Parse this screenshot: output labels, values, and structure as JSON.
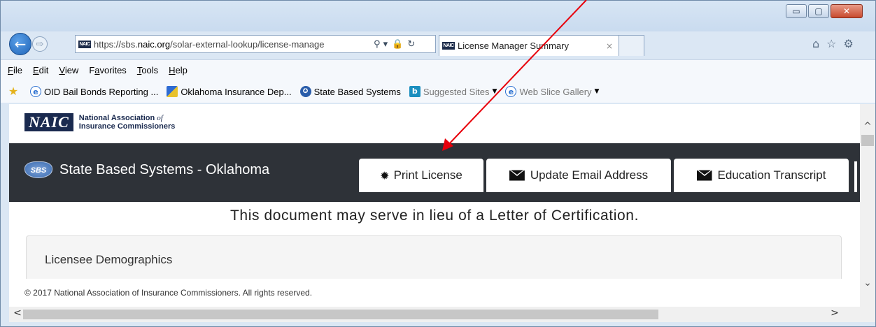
{
  "window": {
    "minimize_glyph": "▭",
    "maximize_glyph": "▢",
    "close_glyph": "✕"
  },
  "nav": {
    "back_glyph": "←",
    "forward_glyph": "⇨"
  },
  "address_bar": {
    "favicon_text": "NAIC",
    "url_prefix": "https://sbs.",
    "url_domain": "naic.org",
    "url_rest": "/solar-external-lookup/license-manage",
    "search_glyph": "⚲ ▾",
    "lock_glyph": "🔒",
    "refresh_glyph": "↻"
  },
  "tabs": {
    "active_label": "License Manager Summary",
    "close_glyph": "×"
  },
  "toolbar_icons": {
    "home": "⌂",
    "favorites": "☆",
    "settings": "⚙"
  },
  "menu": {
    "items": [
      {
        "u": "F",
        "rest": "ile"
      },
      {
        "u": "E",
        "rest": "dit"
      },
      {
        "u": "V",
        "rest": "iew"
      },
      {
        "pre": "F",
        "u": "a",
        "rest": "vorites"
      },
      {
        "u": "T",
        "rest": "ools"
      },
      {
        "u": "H",
        "rest": "elp"
      }
    ]
  },
  "favorites": {
    "star_glyph": "★",
    "items": [
      {
        "label": "OID Bail Bonds Reporting ...",
        "icon": "ie-icon"
      },
      {
        "label": "Oklahoma Insurance Dep...",
        "icon": "ok-icon"
      },
      {
        "label": "State Based Systems",
        "icon": "sbs-icon"
      },
      {
        "label": "Suggested Sites",
        "icon": "bing-icon"
      },
      {
        "label": "Web Slice Gallery",
        "icon": "ie-icon"
      }
    ],
    "dropdown_glyph": "▼"
  },
  "page": {
    "naic_logo": "NAIC",
    "naic_name_line1_a": "National Association ",
    "naic_name_line1_b": "of",
    "naic_name_line2": "Insurance Commissioners",
    "brand_logo": "SBS",
    "brand_title": "State Based Systems - Oklahoma",
    "nav_buttons": {
      "print_icon": "✹",
      "print": "Print License",
      "email": "Update Email Address",
      "education": "Education Transcript"
    },
    "notice": "This document may serve in lieu of a Letter of Certification.",
    "demographics_title": "Licensee Demographics",
    "footer": "© 2017 National Association of Insurance Commissioners. All rights reserved."
  },
  "scrollbars": {
    "up": "^",
    "down": "⌄",
    "left": "<",
    "right": ">"
  },
  "annotation": {
    "color": "#e8000b"
  }
}
